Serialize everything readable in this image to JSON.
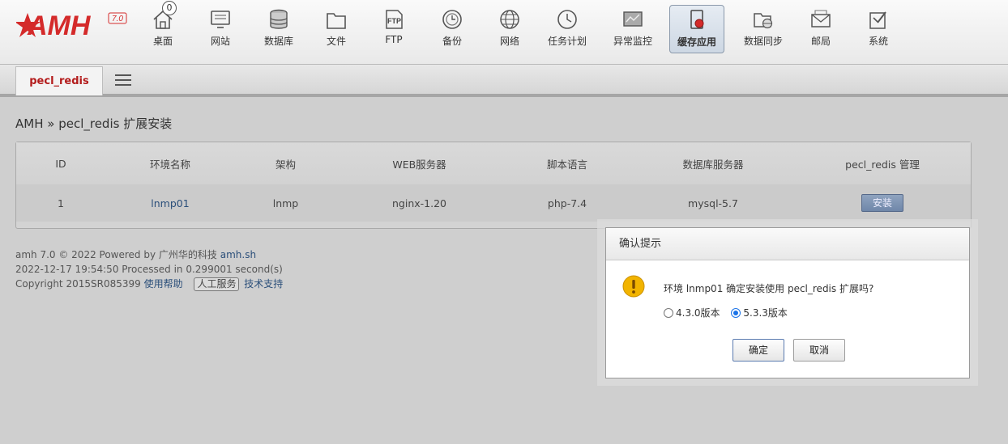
{
  "logo": {
    "text": "AMH",
    "version": "7.0"
  },
  "nav": {
    "home": {
      "label": "桌面",
      "badge": "0"
    },
    "website": {
      "label": "网站"
    },
    "database": {
      "label": "数据库"
    },
    "files": {
      "label": "文件"
    },
    "ftp": {
      "label": "FTP",
      "icon_text": "FTP"
    },
    "backup": {
      "label": "备份"
    },
    "network": {
      "label": "网络"
    },
    "tasks": {
      "label": "任务计划"
    },
    "monitor": {
      "label": "异常监控"
    },
    "cache": {
      "label": "缓存应用"
    },
    "sync": {
      "label": "数据同步"
    },
    "mail": {
      "label": "邮局"
    },
    "system": {
      "label": "系统"
    }
  },
  "tab": {
    "label": "pecl_redis"
  },
  "breadcrumb": "AMH » pecl_redis 扩展安装",
  "table": {
    "headers": [
      "ID",
      "环境名称",
      "架构",
      "WEB服务器",
      "脚本语言",
      "数据库服务器",
      "pecl_redis 管理"
    ],
    "row": {
      "id": "1",
      "env": "lnmp01",
      "arch": "lnmp",
      "web": "nginx-1.20",
      "lang": "php-7.4",
      "db": "mysql-5.7",
      "action": "安装"
    }
  },
  "footer": {
    "line1_prefix": "amh 7.0 © 2022 Powered by 广州华的科技",
    "line1_link": "amh.sh",
    "line2": "2022-12-17 19:54:50 Processed in 0.299001 second(s)",
    "line3_prefix": "Copyright 2015SR085399",
    "help_link": "使用帮助",
    "service": "人工服务",
    "support_link": "技术支持"
  },
  "dialog": {
    "title": "确认提示",
    "message": "环境 lnmp01 确定安装使用 pecl_redis 扩展吗?",
    "option1": "4.3.0版本",
    "option2": "5.3.3版本",
    "selected": "5.3.3版本",
    "ok": "确定",
    "cancel": "取消"
  },
  "colors": {
    "brand_red": "#d42a2a",
    "link": "#2b4f7a",
    "radio_selected": "#1a73e8",
    "warning": "#f2b400"
  }
}
